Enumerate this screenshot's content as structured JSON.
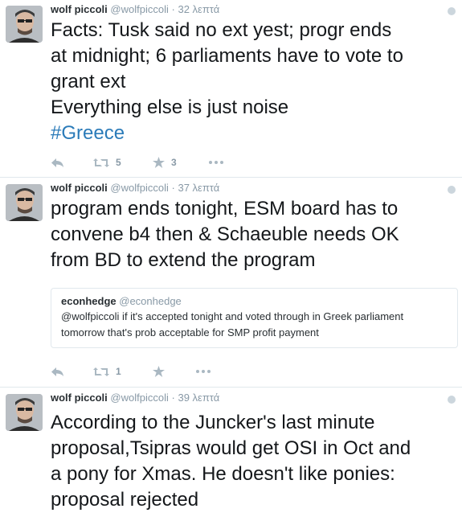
{
  "tweets": [
    {
      "name": "wolf piccoli",
      "handle": "@wolfpiccoli",
      "separator": "·",
      "time": "32 λεπτά",
      "text_lines": [
        "Facts: Tusk said no ext yest; progr ends",
        "at midnight; 6 parliaments have to vote to",
        "grant ext",
        "Everything else is just noise"
      ],
      "hashtag": "#Greece",
      "retweets": "5",
      "favorites": "3"
    },
    {
      "name": "wolf piccoli",
      "handle": "@wolfpiccoli",
      "separator": "·",
      "time": "37 λεπτά",
      "text_lines": [
        "program ends tonight, ESM board has to",
        "convene b4 then & Schaeuble needs OK",
        "from BD to extend the program"
      ],
      "quote": {
        "name": "econhedge",
        "handle": "@econhedge",
        "text_lines": [
          "@wolfpiccoli if it's accepted tonight and voted through in Greek parliament",
          "tomorrow that's prob acceptable for SMP profit payment"
        ]
      },
      "retweets": "1",
      "favorites": ""
    },
    {
      "name": "wolf piccoli",
      "handle": "@wolfpiccoli",
      "separator": "·",
      "time": "39 λεπτά",
      "text_lines": [
        "According to the Juncker's last minute",
        "proposal,Tsipras would get OSI in Oct and",
        "a pony for Xmas. He doesn't like ponies:",
        "proposal rejected"
      ]
    }
  ],
  "icons": [
    "reply-icon",
    "retweet-icon",
    "favorite-star-icon",
    "more-dots-icon",
    "avatar-image"
  ],
  "colors": {
    "hashtag": "#2b7bb9",
    "meta": "#8899a6",
    "text": "#14171a"
  }
}
